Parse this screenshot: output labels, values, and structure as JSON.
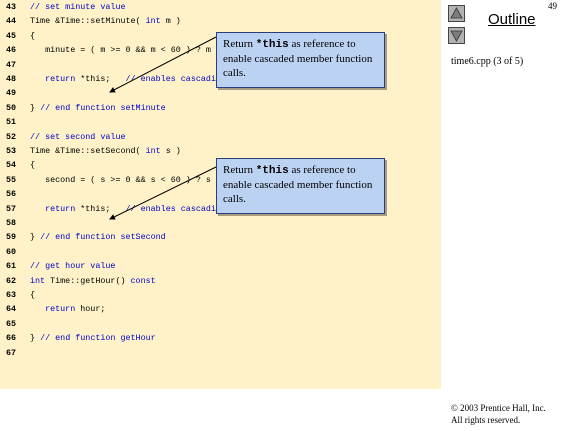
{
  "slide_number": "49",
  "nav": {
    "up_label": "Previous slide",
    "down_label": "Next slide"
  },
  "outline_title": "Outline",
  "file_caption": "time6.cpp (3 of 5)",
  "code_lines": [
    {
      "num": "43",
      "parts": [
        {
          "t": "// set minute value",
          "c": "cm"
        }
      ]
    },
    {
      "num": "44",
      "parts": [
        {
          "t": "Time &Time::setMinute( "
        },
        {
          "t": "int",
          "c": "kw"
        },
        {
          "t": " m )"
        }
      ]
    },
    {
      "num": "45",
      "parts": [
        {
          "t": "{"
        }
      ]
    },
    {
      "num": "46",
      "parts": [
        {
          "t": "   minute = ( m >= 0 && m < 60 ) ? m : 0;"
        }
      ]
    },
    {
      "num": "47",
      "parts": []
    },
    {
      "num": "48",
      "parts": [
        {
          "t": "   "
        },
        {
          "t": "return",
          "c": "kw"
        },
        {
          "t": " *this;   "
        },
        {
          "t": "// enables cascading",
          "c": "cm"
        }
      ]
    },
    {
      "num": "49",
      "parts": []
    },
    {
      "num": "50",
      "parts": [
        {
          "t": "} "
        },
        {
          "t": "// end function setMinute",
          "c": "cm"
        }
      ]
    },
    {
      "num": "51",
      "parts": []
    },
    {
      "num": "52",
      "parts": [
        {
          "t": "// set second value",
          "c": "cm"
        }
      ]
    },
    {
      "num": "53",
      "parts": [
        {
          "t": "Time &Time::setSecond( "
        },
        {
          "t": "int",
          "c": "kw"
        },
        {
          "t": " s )"
        }
      ]
    },
    {
      "num": "54",
      "parts": [
        {
          "t": "{"
        }
      ]
    },
    {
      "num": "55",
      "parts": [
        {
          "t": "   second = ( s >= 0 && s < 60 ) ? s : 0;"
        }
      ]
    },
    {
      "num": "56",
      "parts": []
    },
    {
      "num": "57",
      "parts": [
        {
          "t": "   "
        },
        {
          "t": "return",
          "c": "kw"
        },
        {
          "t": " *this;   "
        },
        {
          "t": "// enables cascading",
          "c": "cm"
        }
      ]
    },
    {
      "num": "58",
      "parts": []
    },
    {
      "num": "59",
      "parts": [
        {
          "t": "} "
        },
        {
          "t": "// end function setSecond",
          "c": "cm"
        }
      ]
    },
    {
      "num": "60",
      "parts": []
    },
    {
      "num": "61",
      "parts": [
        {
          "t": "// get hour value",
          "c": "cm"
        }
      ]
    },
    {
      "num": "62",
      "parts": [
        {
          "t": "int",
          "c": "kw"
        },
        {
          "t": " Time::getHour() "
        },
        {
          "t": "const",
          "c": "kw"
        }
      ]
    },
    {
      "num": "63",
      "parts": [
        {
          "t": "{"
        }
      ]
    },
    {
      "num": "64",
      "parts": [
        {
          "t": "   "
        },
        {
          "t": "return",
          "c": "kw"
        },
        {
          "t": " hour;"
        }
      ]
    },
    {
      "num": "65",
      "parts": []
    },
    {
      "num": "66",
      "parts": [
        {
          "t": "} "
        },
        {
          "t": "// end function getHour",
          "c": "cm"
        }
      ]
    },
    {
      "num": "67",
      "parts": []
    }
  ],
  "callouts": [
    {
      "pre": "Return ",
      "mono": "*this",
      "post": " as reference to enable cascaded member function calls."
    },
    {
      "pre": "Return ",
      "mono": "*this",
      "post": " as reference to enable cascaded member function calls."
    }
  ],
  "copyright": {
    "line1": "© 2003 Prentice Hall, Inc.",
    "line2": "All rights reserved."
  },
  "colors": {
    "code_background": "#fff2c8",
    "callout_background": "#bcd2f2",
    "keyword": "#0000cc",
    "nav_button": "#b2b2b2"
  }
}
